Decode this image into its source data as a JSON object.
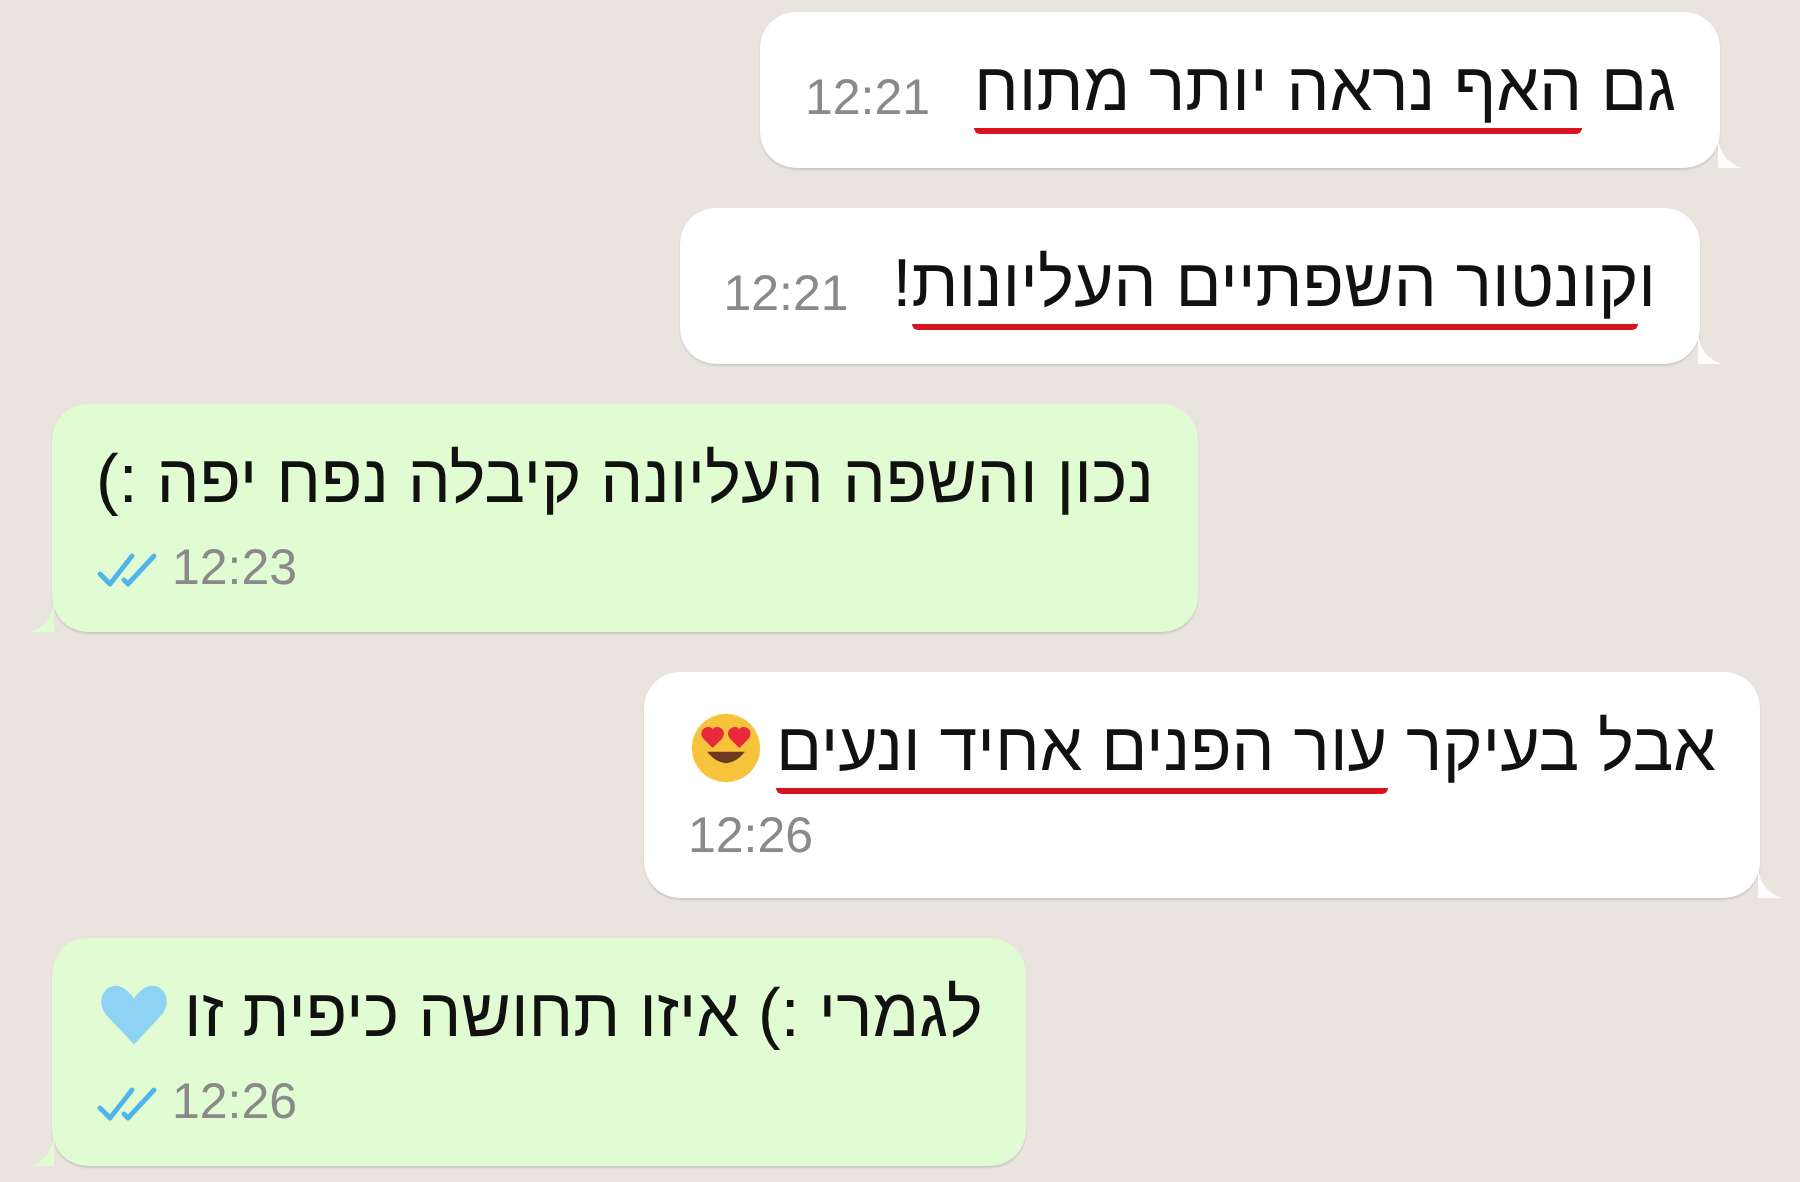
{
  "messages": [
    {
      "kind": "received",
      "time_inline": true,
      "parts": [
        {
          "text": "גם ",
          "underlined": false
        },
        {
          "text": "האף נראה יותר מתוח",
          "underlined": true
        }
      ],
      "time": "12:21"
    },
    {
      "kind": "received",
      "time_inline": true,
      "parts": [
        {
          "text": "ו",
          "underlined": false
        },
        {
          "text": "קונטור השפתיים העליונות",
          "underlined": true
        },
        {
          "text": "!",
          "underlined": false
        }
      ],
      "time": "12:21"
    },
    {
      "kind": "sent",
      "time_inline": false,
      "read": true,
      "parts": [
        {
          "text": "נכון והשפה העליונה קיבלה נפח יפה :)",
          "underlined": false
        }
      ],
      "time": "12:23"
    },
    {
      "kind": "received",
      "time_inline": false,
      "emoji": {
        "kind": "heart_eyes"
      },
      "parts": [
        {
          "text": "אבל בעיקר ",
          "underlined": false
        },
        {
          "text": "עור הפנים אחיד ונעים",
          "underlined": true
        }
      ],
      "time": "12:26"
    },
    {
      "kind": "sent",
      "time_inline": false,
      "read": true,
      "emoji": {
        "kind": "blue_heart"
      },
      "parts": [
        {
          "text": "לגמרי :) איזו תחושה כיפית זו",
          "underlined": false
        }
      ],
      "time": "12:26"
    }
  ]
}
